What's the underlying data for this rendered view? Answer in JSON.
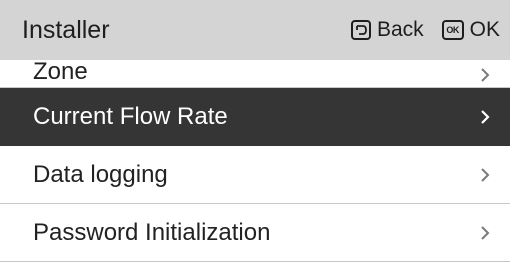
{
  "header": {
    "title": "Installer",
    "back_label": "Back",
    "ok_icon_text": "OK",
    "ok_label": "OK"
  },
  "menu": {
    "items": [
      {
        "label": "Zone",
        "selected": false
      },
      {
        "label": "Current Flow Rate",
        "selected": true
      },
      {
        "label": "Data logging",
        "selected": false
      },
      {
        "label": "Password Initialization",
        "selected": false
      }
    ]
  },
  "colors": {
    "header_bg": "#d4d4d4",
    "selected_bg": "#353535",
    "selected_text": "#ffffff",
    "text": "#222222",
    "chevron": "#7a7a7a"
  },
  "icons": {
    "back": "back-arrow-icon",
    "ok": "ok-key-icon",
    "chevron": "chevron-right-icon"
  }
}
